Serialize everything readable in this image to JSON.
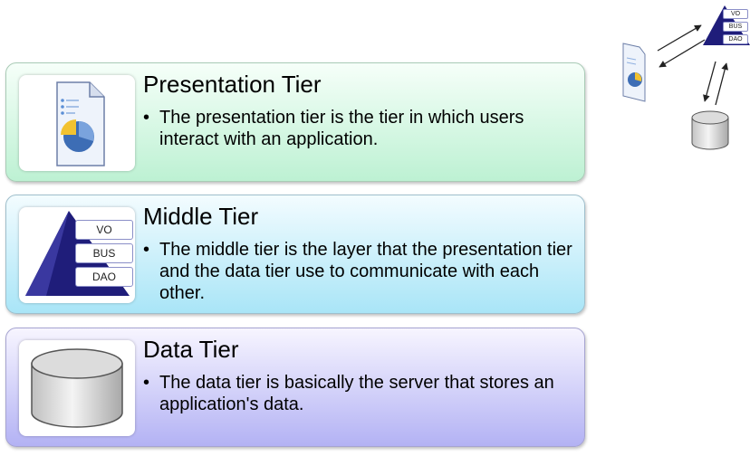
{
  "tiers": [
    {
      "title": "Presentation Tier",
      "bullet": "The presentation tier is the tier in which users interact with an application."
    },
    {
      "title": "Middle Tier",
      "bullet": "The middle tier is the layer that the presentation tier and the data tier use to communicate with each other.",
      "stack_labels": [
        "VO",
        "BUS",
        "DAO"
      ]
    },
    {
      "title": "Data Tier",
      "bullet": "The data tier is basically the server that stores an application's data."
    }
  ],
  "bullet_char": "•",
  "mini_diagram": {
    "stack_labels": [
      "VO",
      "BUS",
      "DAO"
    ]
  },
  "colors": {
    "presentation": "#bdf1d3",
    "middle": "#a9e5f7",
    "data": "#b3b2f4",
    "pyramid": "#1f1d7a"
  }
}
